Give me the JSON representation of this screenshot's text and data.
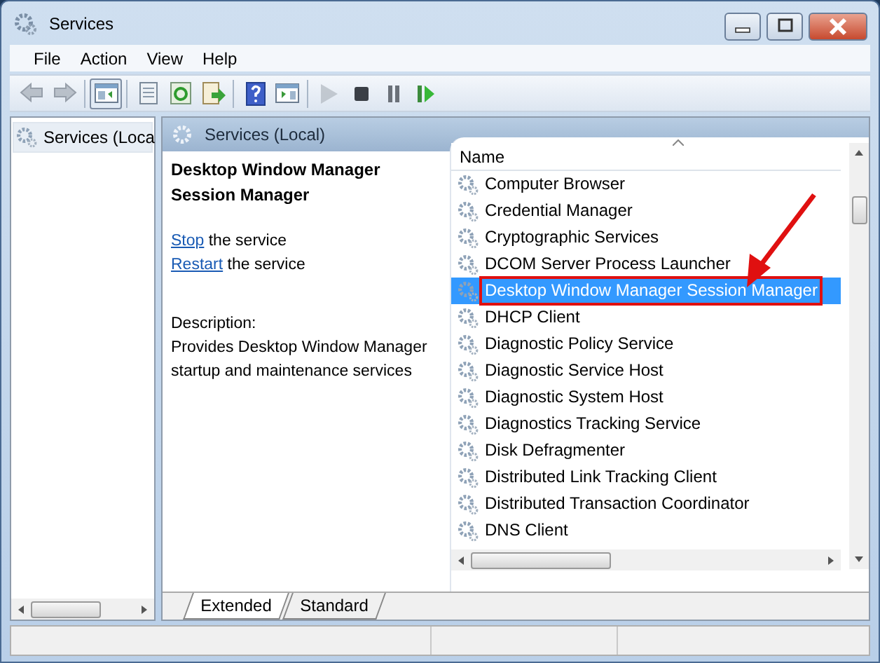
{
  "window": {
    "title": "Services"
  },
  "menu": [
    "File",
    "Action",
    "View",
    "Help"
  ],
  "toolbar": [
    {
      "kind": "back",
      "disabled": true,
      "pressed": false
    },
    {
      "kind": "forward",
      "disabled": true,
      "pressed": false
    },
    {
      "kind": "sep"
    },
    {
      "kind": "tree",
      "disabled": false,
      "pressed": true
    },
    {
      "kind": "sep"
    },
    {
      "kind": "properties",
      "disabled": false,
      "pressed": false
    },
    {
      "kind": "refresh",
      "disabled": false,
      "pressed": false
    },
    {
      "kind": "export",
      "disabled": false,
      "pressed": false
    },
    {
      "kind": "sep"
    },
    {
      "kind": "help",
      "disabled": false,
      "pressed": false
    },
    {
      "kind": "actionpane",
      "disabled": false,
      "pressed": false
    },
    {
      "kind": "sep"
    },
    {
      "kind": "start",
      "disabled": true,
      "pressed": false
    },
    {
      "kind": "stop",
      "disabled": false,
      "pressed": false
    },
    {
      "kind": "pause",
      "disabled": false,
      "pressed": false
    },
    {
      "kind": "resume",
      "disabled": false,
      "pressed": false
    }
  ],
  "tree": {
    "items": [
      {
        "label": "Services (Loca",
        "selected": true
      }
    ]
  },
  "pane_header": "Services (Local)",
  "details": {
    "title": "Desktop Window Manager Session Manager",
    "actions": [
      {
        "link": "Stop",
        "text": " the service"
      },
      {
        "link": "Restart",
        "text": " the service"
      }
    ],
    "description_label": "Description:",
    "description": "Provides Desktop Window Manager startup and maintenance services"
  },
  "list": {
    "column": "Name",
    "rows": [
      {
        "name": "Computer Browser",
        "selected": false,
        "highlighted": false
      },
      {
        "name": "Credential Manager",
        "selected": false,
        "highlighted": false
      },
      {
        "name": "Cryptographic Services",
        "selected": false,
        "highlighted": false
      },
      {
        "name": "DCOM Server Process Launcher",
        "selected": false,
        "highlighted": false
      },
      {
        "name": "Desktop Window Manager Session Manager",
        "selected": true,
        "highlighted": true
      },
      {
        "name": "DHCP Client",
        "selected": false,
        "highlighted": false
      },
      {
        "name": "Diagnostic Policy Service",
        "selected": false,
        "highlighted": false
      },
      {
        "name": "Diagnostic Service Host",
        "selected": false,
        "highlighted": false
      },
      {
        "name": "Diagnostic System Host",
        "selected": false,
        "highlighted": false
      },
      {
        "name": "Diagnostics Tracking Service",
        "selected": false,
        "highlighted": false
      },
      {
        "name": "Disk Defragmenter",
        "selected": false,
        "highlighted": false
      },
      {
        "name": "Distributed Link Tracking Client",
        "selected": false,
        "highlighted": false
      },
      {
        "name": "Distributed Transaction Coordinator",
        "selected": false,
        "highlighted": false
      },
      {
        "name": "DNS Client",
        "selected": false,
        "highlighted": false
      }
    ]
  },
  "callout_arrow": true,
  "tabs": [
    {
      "label": "Extended",
      "selected": true
    },
    {
      "label": "Standard",
      "selected": false
    }
  ]
}
